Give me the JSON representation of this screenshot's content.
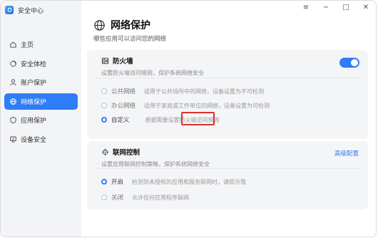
{
  "app": {
    "title": "安全中心"
  },
  "window_controls": {
    "menu": "≡",
    "minimize": "−",
    "maximize": "□",
    "close": "✕"
  },
  "sidebar": {
    "items": [
      {
        "label": "主页",
        "icon": "home-icon",
        "active": false
      },
      {
        "label": "安全体检",
        "icon": "checkup-icon",
        "active": false
      },
      {
        "label": "账户保护",
        "icon": "user-icon",
        "active": false
      },
      {
        "label": "网络保护",
        "icon": "globe-icon",
        "active": true
      },
      {
        "label": "应用保护",
        "icon": "shield-icon",
        "active": false
      },
      {
        "label": "设备安全",
        "icon": "device-icon",
        "active": false
      }
    ]
  },
  "page": {
    "title": "网络保护",
    "subtitle": "哪些应用可以访问您的网络"
  },
  "firewall": {
    "title": "防火墙",
    "desc": "设置防火墙访问规则，保护系统网络安全",
    "enabled": true,
    "options": [
      {
        "label": "公共网络",
        "desc": "适用于公共场所中的网络，设备设置为不可检测",
        "selected": false
      },
      {
        "label": "办公网络",
        "desc": "适用于家庭或工作单位的网络，设备设置为可检测",
        "selected": false
      },
      {
        "label": "自定义",
        "desc": "根据需要设置防火墙访问规则",
        "selected": true
      }
    ]
  },
  "network_control": {
    "title": "联网控制",
    "desc": "设置应用联网控制策略，保护系统网络安全",
    "advanced_link": "高级配置",
    "options": [
      {
        "label": "开启",
        "desc": "检测到未授权的应用和服务联网时，请提示我",
        "selected": true
      },
      {
        "label": "关闭",
        "desc": "允许任何应用程序联网",
        "selected": false
      }
    ]
  },
  "colors": {
    "accent": "#2f7df6",
    "highlight": "#e0302a"
  }
}
